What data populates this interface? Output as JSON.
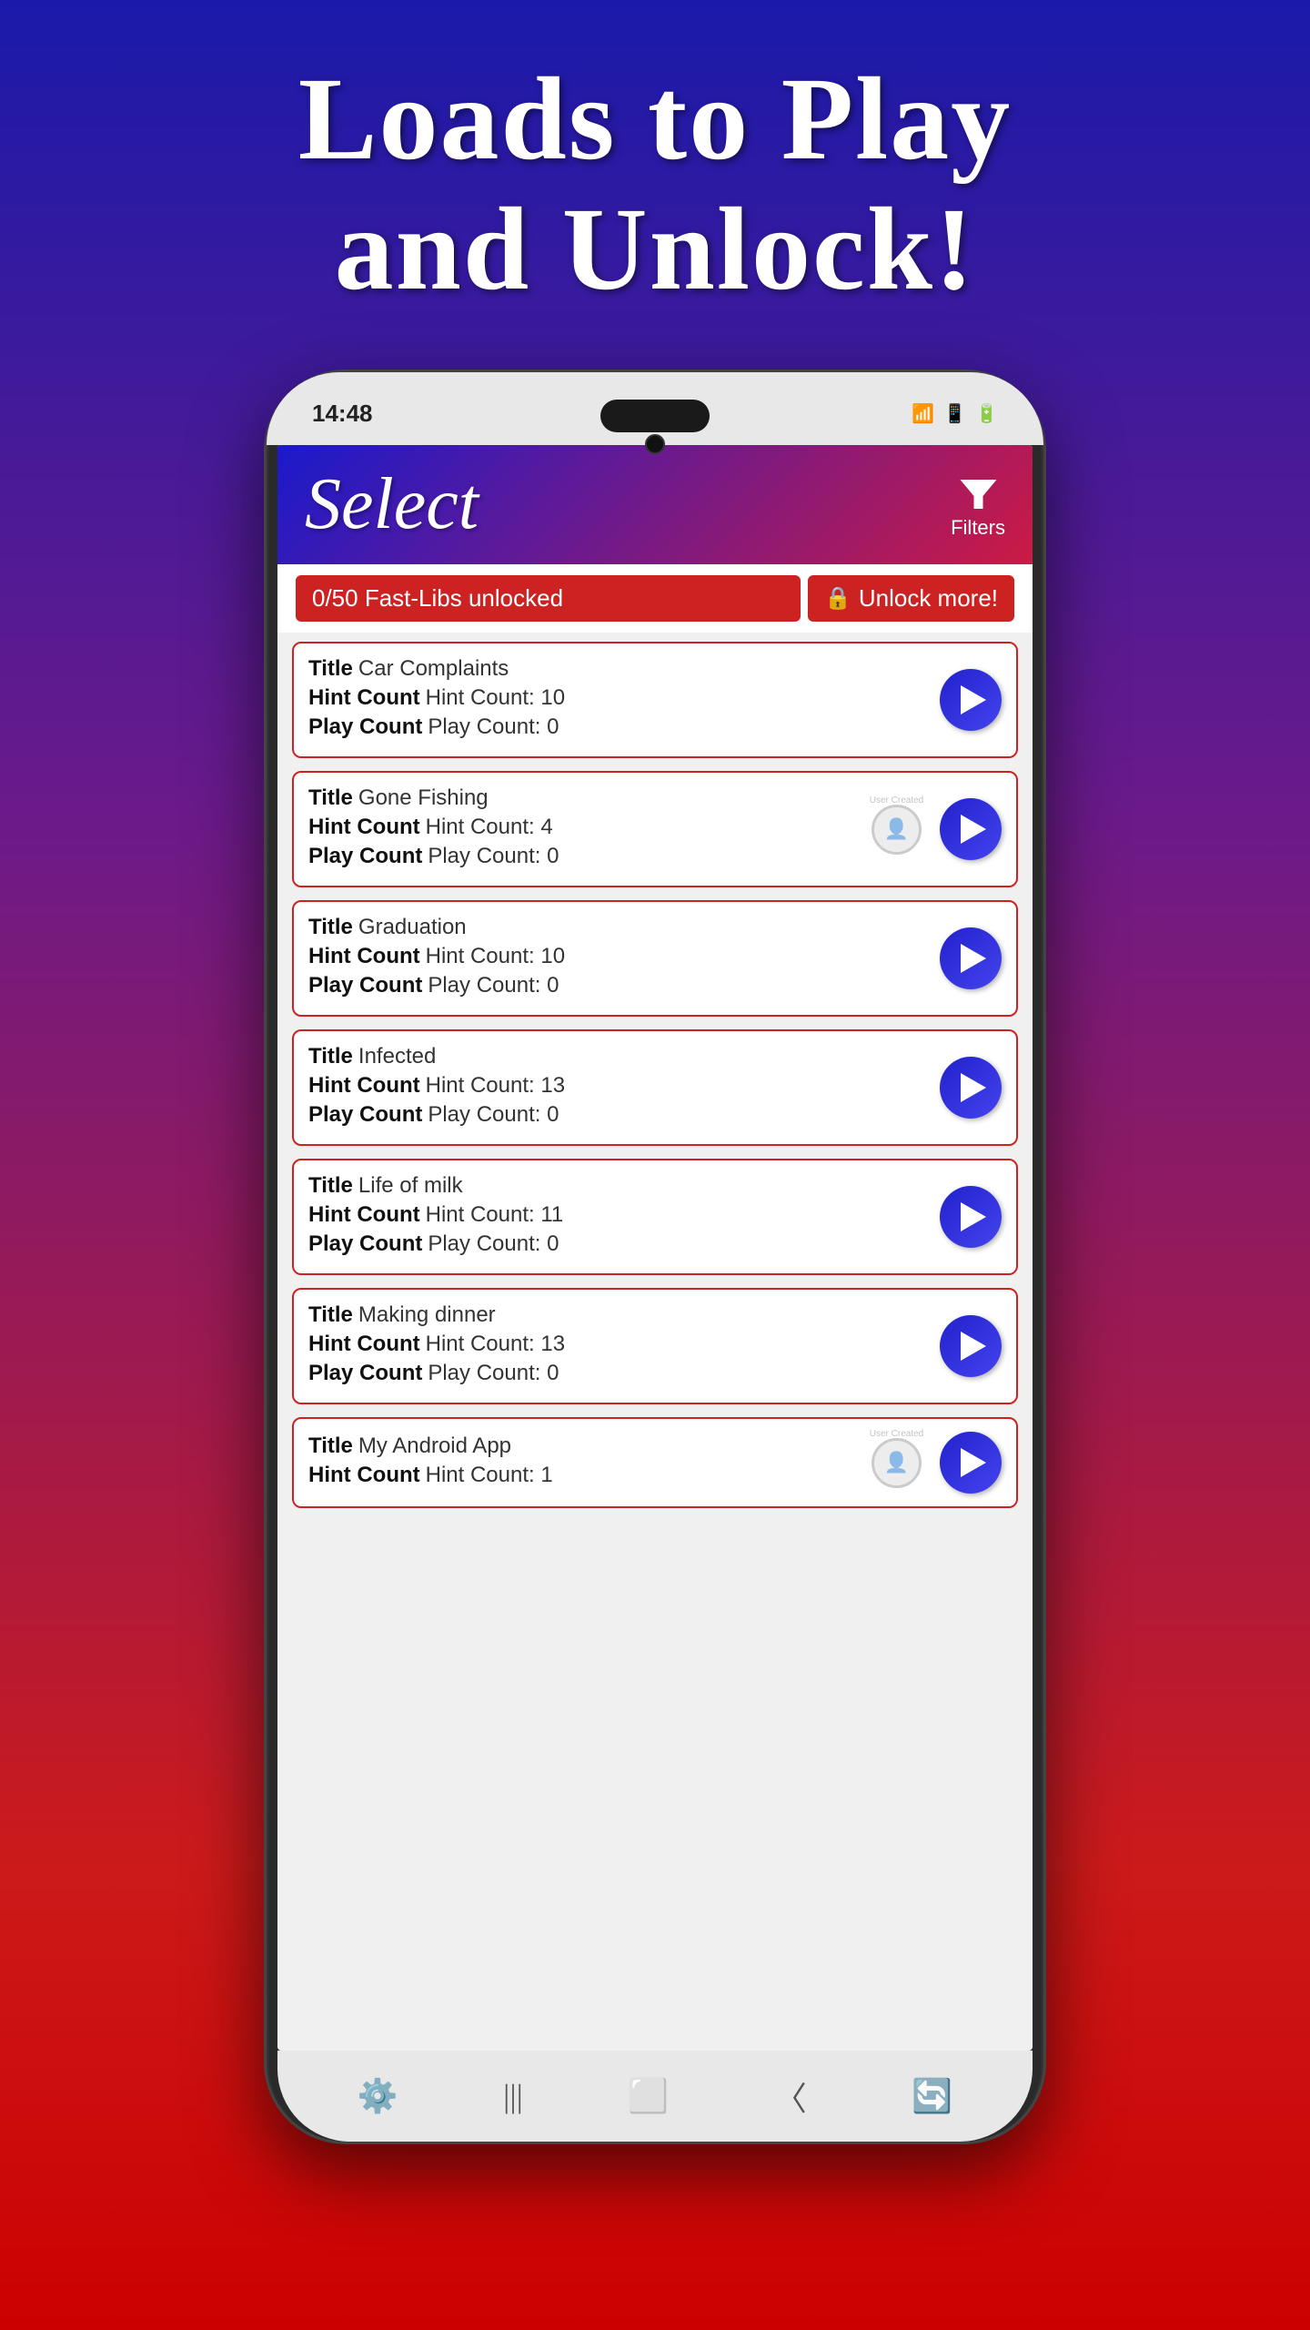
{
  "hero": {
    "title_line1": "Loads to Play",
    "title_line2": "and Unlock!"
  },
  "status_bar": {
    "time": "14:48",
    "icons": "📷 📱 🔋"
  },
  "app_header": {
    "title": "Select",
    "filter_label": "Filters"
  },
  "unlock_bar": {
    "count_text": "0/50 Fast-Libs unlocked",
    "unlock_btn": "Unlock more!"
  },
  "list_items": [
    {
      "title": "Car Complaints",
      "hint_count": "Hint Count: 10",
      "play_count": "Play Count: 0",
      "user_created": false
    },
    {
      "title": "Gone Fishing",
      "hint_count": "Hint Count: 4",
      "play_count": "Play Count: 0",
      "user_created": true
    },
    {
      "title": "Graduation",
      "hint_count": "Hint Count: 10",
      "play_count": "Play Count: 0",
      "user_created": false
    },
    {
      "title": "Infected",
      "hint_count": "Hint Count: 13",
      "play_count": "Play Count: 0",
      "user_created": false
    },
    {
      "title": "Life of milk",
      "hint_count": "Hint Count: 11",
      "play_count": "Play Count: 0",
      "user_created": false
    },
    {
      "title": "Making dinner",
      "hint_count": "Hint Count: 13",
      "play_count": "Play Count: 0",
      "user_created": false
    },
    {
      "title": "My Android App",
      "hint_count": "Hint Count: 1",
      "play_count": "",
      "user_created": true
    }
  ],
  "labels": {
    "title": "Title",
    "hint_count": "Hint Count",
    "play_count": "Play Count"
  }
}
